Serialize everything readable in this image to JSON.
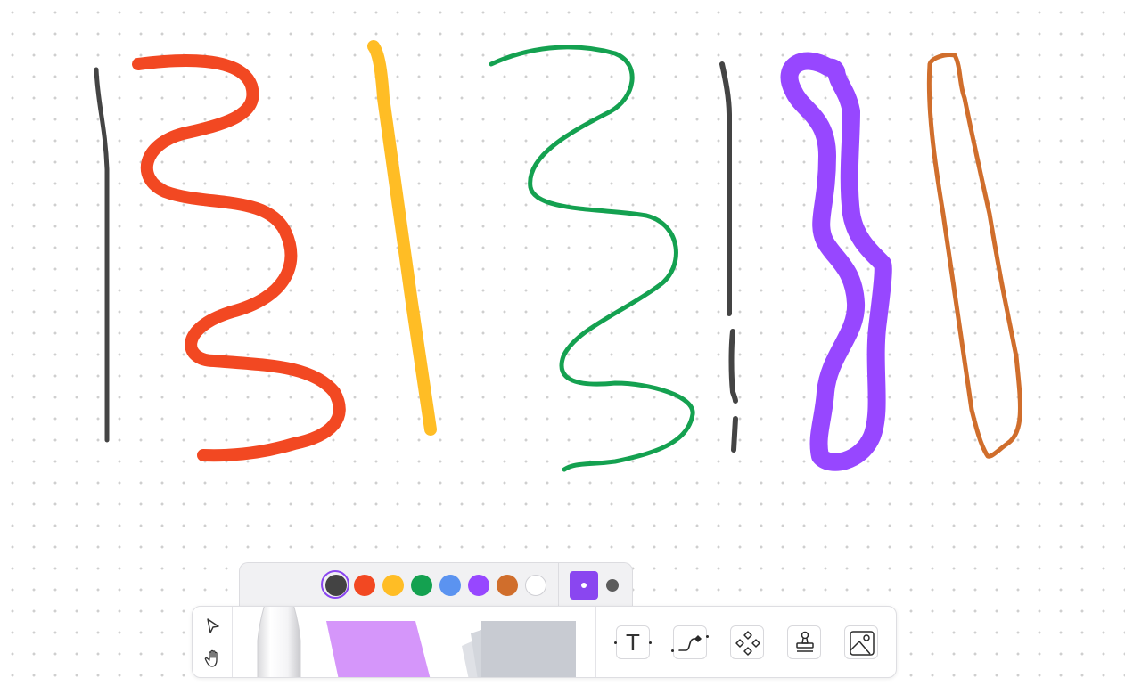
{
  "canvas": {
    "strokes": [
      {
        "name": "stroke-dark-thin",
        "color": "#444444"
      },
      {
        "name": "stroke-red-wave",
        "color": "#f24822"
      },
      {
        "name": "stroke-yellow-line",
        "color": "#ffbd25"
      },
      {
        "name": "stroke-green-wave",
        "color": "#14a150"
      },
      {
        "name": "stroke-dark-dashed",
        "color": "#444444"
      },
      {
        "name": "stroke-purple-loop",
        "color": "#9747ff"
      },
      {
        "name": "stroke-orange-loop",
        "color": "#d06e2c"
      }
    ]
  },
  "palette": {
    "colors": [
      {
        "name": "charcoal",
        "hex": "#434343",
        "selected": true
      },
      {
        "name": "red",
        "hex": "#f24822"
      },
      {
        "name": "yellow",
        "hex": "#ffbd25"
      },
      {
        "name": "green",
        "hex": "#14a150"
      },
      {
        "name": "blue",
        "hex": "#5b93f0"
      },
      {
        "name": "purple",
        "hex": "#9747ff"
      },
      {
        "name": "orange",
        "hex": "#d06e2c"
      },
      {
        "name": "white",
        "hex": "#ffffff"
      }
    ],
    "stroke_sizes": [
      "thin",
      "thick"
    ],
    "selected_size": "thin"
  },
  "toolbar": {
    "tools_left": [
      "move-icon",
      "hand-icon"
    ],
    "drawer_items": [
      "marker-pen",
      "sticky-note",
      "section-stack"
    ],
    "tools_right": [
      "text-icon",
      "connector-icon",
      "shapes-icon",
      "stamp-icon",
      "image-icon"
    ],
    "text_tool_glyph": "T",
    "sticky_color": "#d596fa",
    "stack_color": "#c8cbd2",
    "accent": "#8a46f0"
  }
}
